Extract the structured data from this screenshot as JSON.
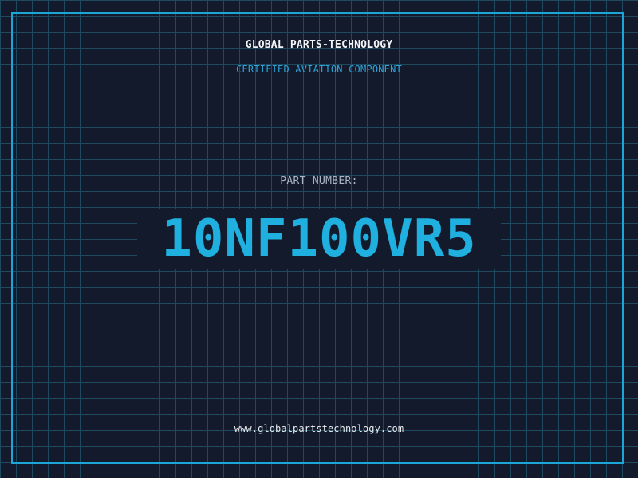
{
  "header": {
    "company_name": "GLOBAL PARTS-TECHNOLOGY",
    "subtitle": "CERTIFIED AVIATION COMPONENT"
  },
  "part": {
    "label": "PART NUMBER:",
    "number": "10NF100VR5"
  },
  "footer": {
    "website": "www.globalpartstechnology.com"
  },
  "colors": {
    "background": "#121a2c",
    "grid": "#1d4a5e",
    "frame": "#1aa7d6",
    "accent": "#1fb0e0",
    "subtitle": "#2ea3d6",
    "label": "#a9b4c4",
    "text": "#f2f4f7"
  }
}
